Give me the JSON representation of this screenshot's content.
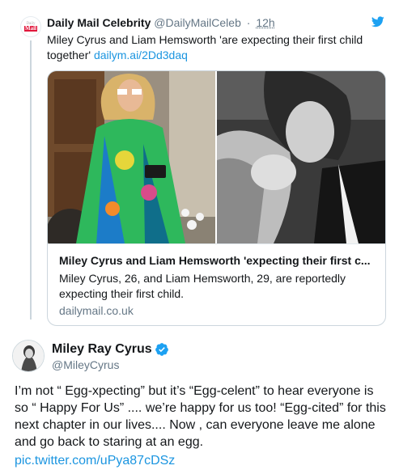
{
  "quoted_tweet": {
    "author_name": "Daily Mail Celebrity",
    "handle": "@DailyMailCeleb",
    "separator": "·",
    "time": "12h",
    "avatar_text_top": "Daily",
    "avatar_text_bottom": "Mail",
    "text": "Miley Cyrus and Liam Hemsworth 'are expecting their first child together'",
    "link": "dailym.ai/2Dd3daq",
    "card": {
      "title": "Miley Cyrus and Liam Hemsworth 'expecting their first c...",
      "description": "Miley Cyrus, 26, and Liam Hemsworth, 29, are reportedly expecting their first child.",
      "domain": "dailymail.co.uk"
    }
  },
  "main_tweet": {
    "author_name": "Miley Ray Cyrus",
    "handle": "@MileyCyrus",
    "text": "I’m not “ Egg-xpecting” but it’s “Egg-celent” to hear everyone is so “ Happy For Us” .... we’re happy for us too! “Egg-cited” for this next chapter in our lives.... Now , can everyone leave me alone and go back to staring at an egg.",
    "link": "pic.twitter.com/uPya87cDSz"
  },
  "colors": {
    "link_blue": "#1b95e0",
    "secondary_text": "#657786",
    "verified_blue": "#1da1f2",
    "daily_mail_red": "#e1173b"
  },
  "icons": [
    "twitter-bird-icon",
    "verified-badge-icon"
  ]
}
